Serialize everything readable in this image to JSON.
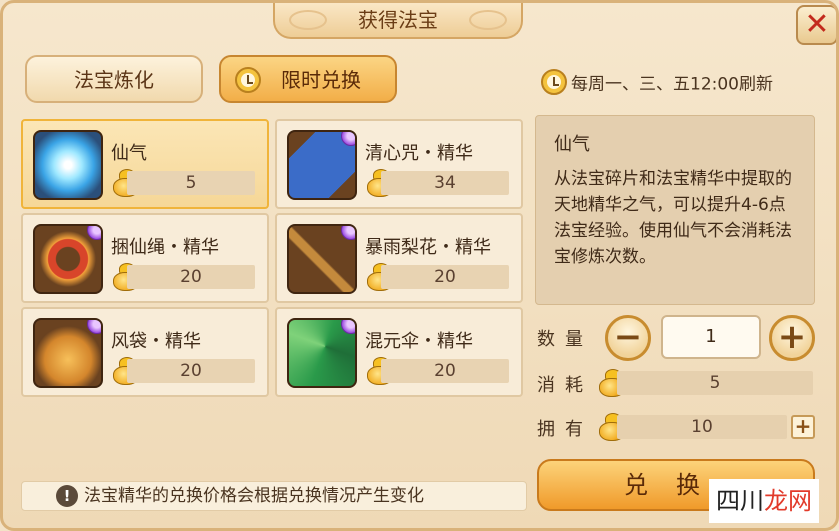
{
  "window": {
    "title": "获得法宝",
    "close_label": "✕"
  },
  "tabs": [
    {
      "label": "法宝炼化",
      "active": false
    },
    {
      "label": "限时兑换",
      "active": true
    }
  ],
  "refresh_text": "每周一、三、五12:00刷新",
  "items": [
    {
      "name": "仙气",
      "cost": "5",
      "icon": "spirit-cloud-icon",
      "selected": true
    },
    {
      "name": "清心咒・精华",
      "cost": "34",
      "icon": "scripture-book-icon",
      "selected": false
    },
    {
      "name": "捆仙绳・精华",
      "cost": "20",
      "icon": "rope-icon",
      "selected": false
    },
    {
      "name": "暴雨梨花・精华",
      "cost": "20",
      "icon": "crossbow-icon",
      "selected": false
    },
    {
      "name": "风袋・精华",
      "cost": "20",
      "icon": "wind-bag-icon",
      "selected": false
    },
    {
      "name": "混元伞・精华",
      "cost": "20",
      "icon": "umbrella-icon",
      "selected": false
    }
  ],
  "notice": "法宝精华的兑换价格会根据兑换情况产生变化",
  "detail": {
    "title": "仙气",
    "text": "从法宝碎片和法宝精华中提取的天地精华之气，可以提升4-6点法宝经验。使用仙气不会消耗法宝修炼次数。"
  },
  "quantity": {
    "label": "数量",
    "value": "1",
    "minus": "−",
    "plus": "+"
  },
  "consume": {
    "label": "消耗",
    "value": "5"
  },
  "owned": {
    "label": "拥有",
    "value": "10",
    "add": "+"
  },
  "exchange_button": "兑换",
  "watermark": {
    "part1": "四川",
    "part2": "龙网"
  },
  "colors": {
    "accent": "#f2ae48",
    "close": "#c32a1c",
    "selected_border": "#f0b43a"
  }
}
